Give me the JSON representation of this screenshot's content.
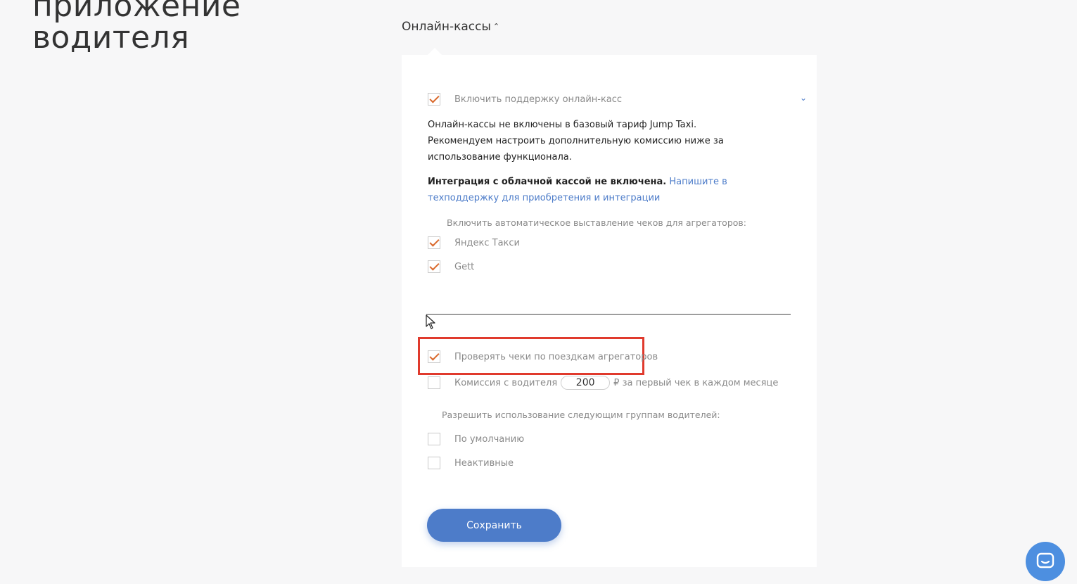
{
  "page": {
    "title_line1": "приложение",
    "title_line2": "водителя"
  },
  "section": {
    "toggle_label": "Онлайн-кассы",
    "toggle_icon": "chevron-up-icon"
  },
  "online_kassy": {
    "enable_label": "Включить поддержку онлайн-касс",
    "enable_checked": true,
    "collapse_icon": "chevron-down-icon",
    "info_line1": "Онлайн-кассы не включены в базовый тариф Jump Taxi.",
    "info_line2": "Рекомендуем настроить дополнительную комиссию ниже за использование функционала.",
    "integration_bold": "Интеграция с облачной кассой не включена.",
    "integration_link": "Напишите в техподдержку для приобретения и интеграции"
  },
  "aggregators": {
    "heading": "Включить автоматическое выставление чеков для агрегаторов:",
    "items": [
      {
        "label": "Яндекс Такси",
        "checked": true
      },
      {
        "label": "Gett",
        "checked": true
      }
    ]
  },
  "checks": {
    "verify_label": "Проверять чеки по поездкам агрегаторов",
    "verify_checked": true,
    "commission_label": "Комиссия с водителя",
    "commission_checked": false,
    "commission_value": "200",
    "commission_unit": "₽ за первый чек в каждом месяце"
  },
  "groups": {
    "heading": "Разрешить использование следующим группам водителей:",
    "items": [
      {
        "label": "По умолчанию",
        "checked": false
      },
      {
        "label": "Неактивные",
        "checked": false
      }
    ]
  },
  "actions": {
    "save_label": "Сохранить"
  },
  "colors": {
    "accent": "#4d7cc9",
    "check": "#d9682b",
    "highlight": "#e03a2d",
    "chat": "#4d8fe0"
  },
  "chat_widget": {
    "icon": "chat-icon"
  }
}
